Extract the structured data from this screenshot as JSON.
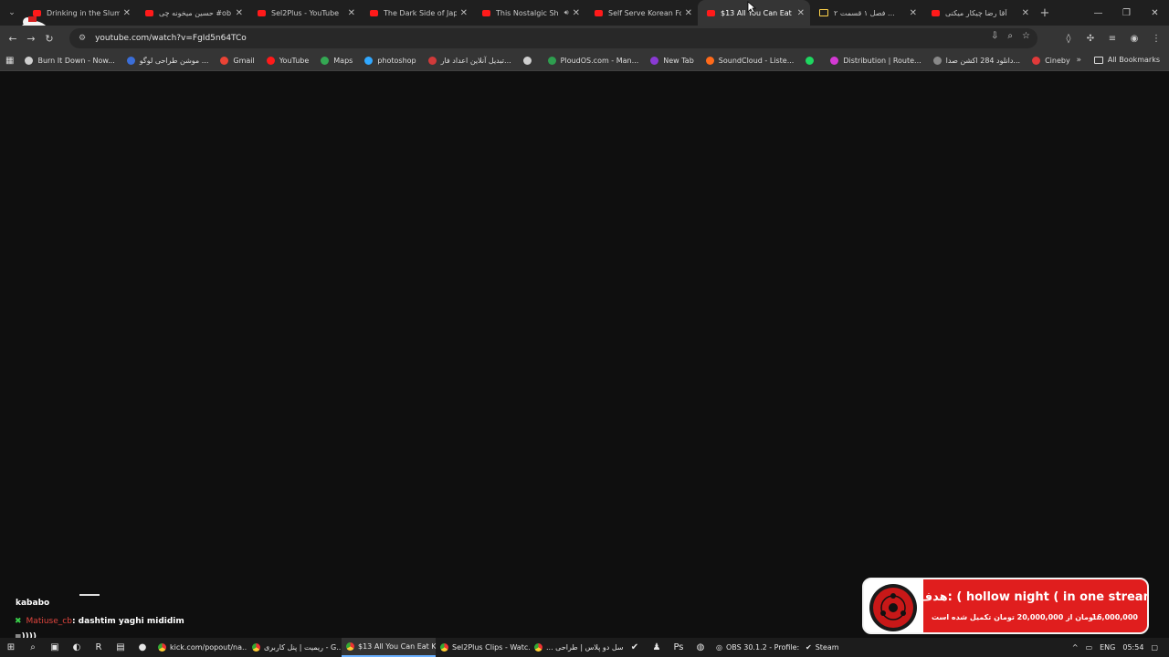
{
  "tabs": [
    {
      "title": "Drinking in the Slum",
      "icon": "youtube-icon",
      "active": false
    },
    {
      "title": "حسین میخونه چی #ob",
      "icon": "youtube-icon",
      "active": false
    },
    {
      "title": "Sel2Plus - YouTube",
      "icon": "youtube-icon",
      "active": false
    },
    {
      "title": "The Dark Side of Jap",
      "icon": "youtube-icon",
      "active": false
    },
    {
      "title": "This Nostalgic Sh",
      "icon": "youtube-icon",
      "active": false,
      "audio": true
    },
    {
      "title": "Self Serve Korean Fo",
      "icon": "youtube-icon",
      "active": false
    },
    {
      "title": "$13 All You Can Eat K",
      "icon": "youtube-icon",
      "active": true
    },
    {
      "title": "فصل ۱ قسمت ۲ ...",
      "icon": "folder-icon",
      "active": false
    },
    {
      "title": "آقا رضا چیکار میکنی",
      "icon": "youtube-icon",
      "active": false
    }
  ],
  "toolbar": {
    "url": "youtube.com/watch?v=FgId5n64TCo"
  },
  "bookmarks": [
    {
      "label": "Burn It Down - Now...",
      "color": "#cfcfcf"
    },
    {
      "label": "موشن طراحی لوگو ...",
      "color": "#3b6ed8"
    },
    {
      "label": "Gmail",
      "color": "#ea4335"
    },
    {
      "label": "YouTube",
      "color": "#ff1a1a"
    },
    {
      "label": "Maps",
      "color": "#34a853"
    },
    {
      "label": "photoshop",
      "color": "#31a8ff"
    },
    {
      "label": "تبدیل آنلاین اعداد فار...",
      "color": "#d03a3a"
    },
    {
      "label": "",
      "color": "#cfcfcf"
    },
    {
      "label": "PloudOS.com - Man...",
      "color": "#2e9e4f"
    },
    {
      "label": "New Tab",
      "color": "#8a3ad4"
    },
    {
      "label": "SoundCloud - Liste...",
      "color": "#ff6a1a"
    },
    {
      "label": "",
      "color": "#1ed760"
    },
    {
      "label": "Distribution | Route...",
      "color": "#d43ad4"
    },
    {
      "label": "دانلود 284 اکشن صدا...",
      "color": "#888888"
    },
    {
      "label": "Cineby",
      "color": "#e03a3a"
    }
  ],
  "bookmarks_all": "All Bookmarks",
  "chat": {
    "user1": "kababo",
    "user2": "Matiuse_cb",
    "message2": ": dashtim yaghi mididim",
    "line3": "=))))"
  },
  "goal": {
    "title": "هدف: ( hollow night ( in one stream",
    "sub": "تومان از 20,000,000 تومان تکمیل شده است.",
    "amount": "16,000,000"
  },
  "taskbar": {
    "apps": [
      {
        "label": "kick.com/popout/na...",
        "active": false
      },
      {
        "label": "ریمیت | پنل کاربری - G...",
        "active": false
      },
      {
        "label": "$13 All You Can Eat K...",
        "active": true
      },
      {
        "label": "Sel2Plus Clips - Watc...",
        "active": false
      },
      {
        "label": "... سل دو پلاس | طراحی",
        "active": false
      }
    ],
    "obs": "OBS 30.1.2 - Profile: U...",
    "steam": "Steam",
    "lang": "ENG",
    "time": "05:54"
  }
}
